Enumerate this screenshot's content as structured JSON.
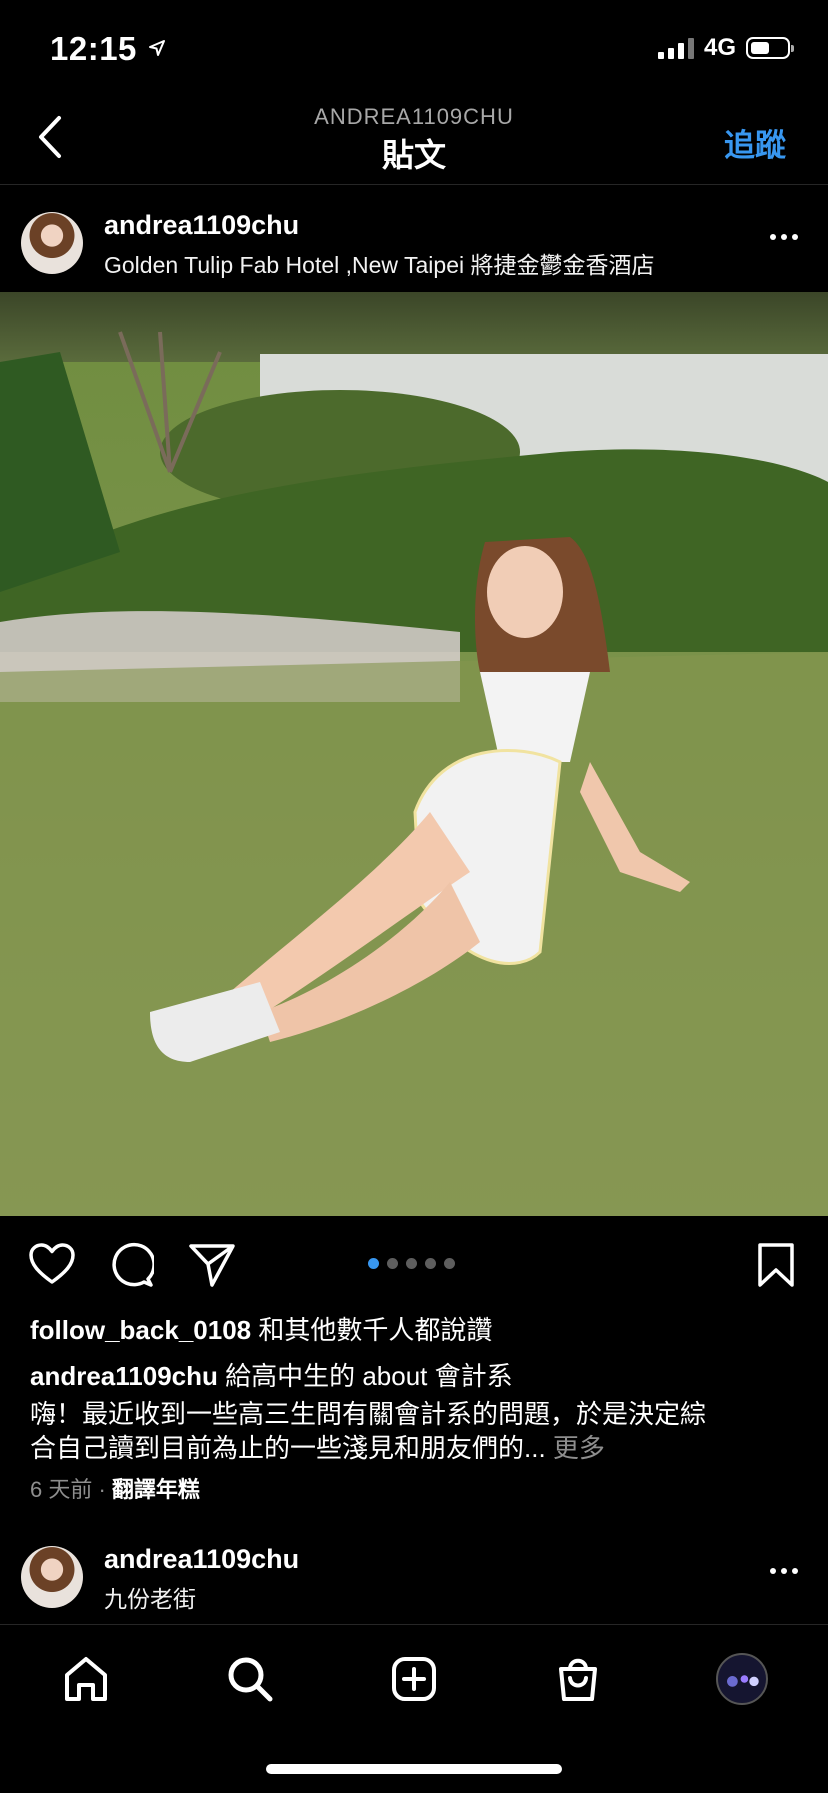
{
  "status": {
    "time": "12:15",
    "network": "4G"
  },
  "header": {
    "subtitle": "ANDREA1109CHU",
    "title": "貼文",
    "follow_label": "追蹤"
  },
  "post": {
    "username": "andrea1109chu",
    "location": "Golden Tulip Fab Hotel ,New Taipei 將捷金鬱金香酒店",
    "carousel": {
      "count": 5,
      "active": 1
    },
    "likes_user": "follow_back_0108",
    "likes_suffix": " 和其他數千人都說讚",
    "caption_user": "andrea1109chu",
    "caption_title": " 給高中生的 about 會計系",
    "caption_line1": "嗨！最近收到一些高三生問有關會計系的問題，於是決定綜",
    "caption_line2": "合自己讀到目前為止的一些淺見和朋友們的...",
    "more_label": " 更多",
    "time_ago": "6 天前",
    "meta_sep": " · ",
    "translate_label": "翻譯年糕"
  },
  "next_post": {
    "username": "andrea1109chu",
    "location": "九份老街"
  },
  "colors": {
    "accent": "#3897f0",
    "background": "#000000",
    "muted": "#8e8e8e"
  },
  "icons": [
    "back-chevron-icon",
    "heart-icon",
    "comment-icon",
    "share-icon",
    "bookmark-icon",
    "home-icon",
    "search-icon",
    "new-post-icon",
    "shop-icon",
    "more-icon"
  ]
}
